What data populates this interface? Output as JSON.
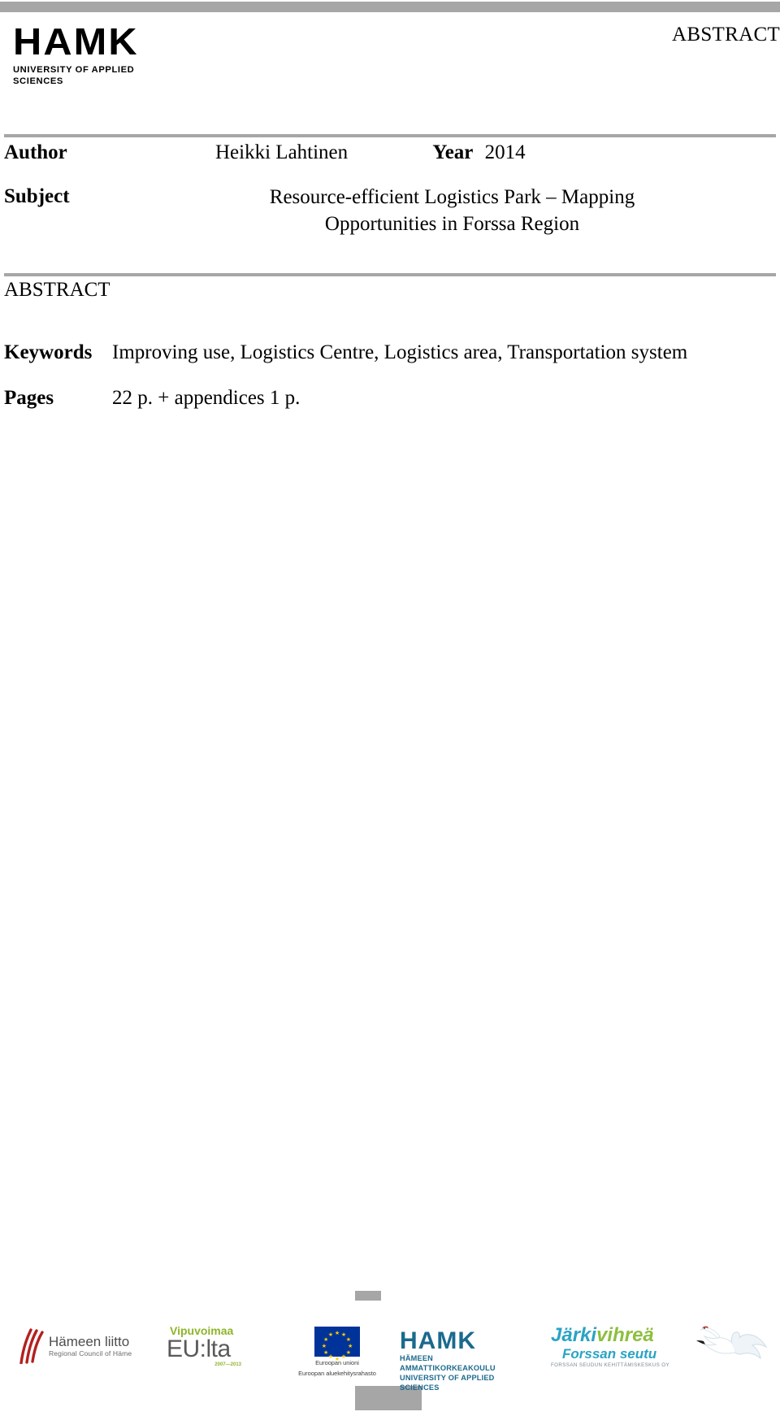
{
  "document": {
    "page_label": "ABSTRACT",
    "header_logo": {
      "wordmark": "HAMK",
      "tagline": "UNIVERSITY OF APPLIED SCIENCES"
    },
    "meta": {
      "author_label": "Author",
      "author_value": "Heikki Lahtinen",
      "year_label": "Year",
      "year_value": "2014",
      "subject_label": "Subject",
      "subject_value": "Resource-efficient Logistics Park – Mapping Opportunities in Forssa Region"
    },
    "abstract_heading": "ABSTRACT",
    "keywords_label": "Keywords",
    "keywords_value": "Improving use, Logistics Centre, Logistics area, Transportation system",
    "pages_label": "Pages",
    "pages_value": "22 p. + appendices 1 p."
  },
  "footer": {
    "hameen": {
      "main": "Hämeen liitto",
      "sub": "Regional Council of Häme"
    },
    "vipuvoimaa": {
      "top": "Vipuvoimaa",
      "main": "EU:lta",
      "years": "2007—2013"
    },
    "eu": {
      "line1": "Euroopan unioni",
      "line2": "Euroopan aluekehitysrahasto"
    },
    "hamk": {
      "wordmark": "HAMK",
      "line1": "HÄMEEN AMMATTIKORKEAKOULU",
      "line2": "UNIVERSITY OF APPLIED SCIENCES"
    },
    "jarkivihrea": {
      "part_a": "Järki",
      "part_b": "vihreä",
      "line2": "Forssan seutu",
      "line3": "FORSSAN SEUDUN KEHITTÄMISKESKUS OY"
    }
  },
  "colors": {
    "rule_gray": "#a6a6a6",
    "hamk_teal": "#1b6a8e",
    "eu_blue": "#003399",
    "eu_yellow": "#ffcc00",
    "green": "#8fb52a",
    "cyan": "#2aa3c4"
  }
}
